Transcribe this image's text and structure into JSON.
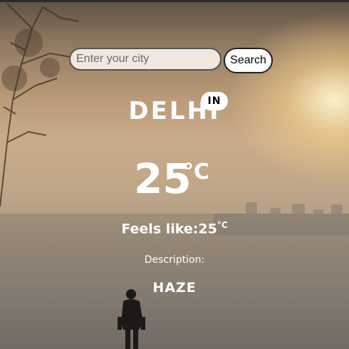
{
  "search": {
    "placeholder": "Enter your city",
    "value": "",
    "button_label": "Search"
  },
  "location": {
    "city": "DELHI",
    "country": "IN"
  },
  "weather": {
    "temperature": "25",
    "unit": "°C",
    "feels_like_label": "Feels like:",
    "feels_like_value": "25",
    "feels_like_unit": "°C",
    "description_label": "Description:",
    "description": "HAZE"
  },
  "background": {
    "scene": "hazy sunrise with cyclist",
    "sky_color": "#c9ab89",
    "text_color": "#ffffff"
  }
}
